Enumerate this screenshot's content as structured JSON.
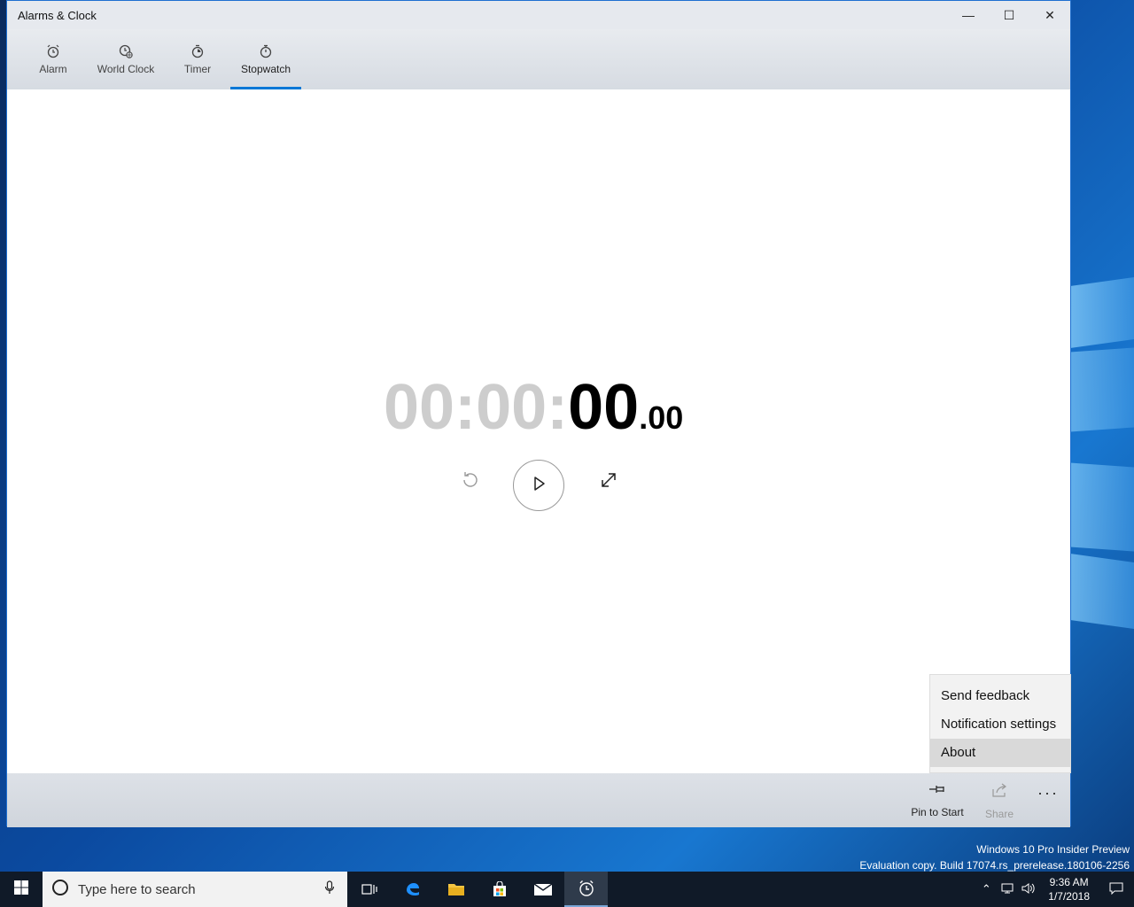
{
  "window": {
    "title": "Alarms & Clock",
    "controls": {
      "minimize": "—",
      "maximize": "☐",
      "close": "✕"
    }
  },
  "tabs": [
    {
      "label": "Alarm",
      "icon": "alarm-clock-icon"
    },
    {
      "label": "World Clock",
      "icon": "world-clock-icon"
    },
    {
      "label": "Timer",
      "icon": "timer-icon"
    },
    {
      "label": "Stopwatch",
      "icon": "stopwatch-icon",
      "active": true
    }
  ],
  "stopwatch": {
    "hours": "00:",
    "minutes": "00:",
    "seconds": "00",
    "fraction": ".00",
    "buttons": {
      "reset": "reset-icon",
      "play": "play-icon",
      "expand": "expand-icon"
    }
  },
  "menu": {
    "items": [
      "Send feedback",
      "Notification settings",
      "About"
    ],
    "highlighted": "About"
  },
  "appbar": {
    "pin_label": "Pin to Start",
    "share_label": "Share",
    "more": "···"
  },
  "watermark": {
    "line1": "Windows 10 Pro Insider Preview",
    "line2": "Evaluation copy. Build 17074.rs_prerelease.180106-2256"
  },
  "taskbar": {
    "search_placeholder": "Type here to search",
    "time": "9:36 AM",
    "date": "1/7/2018",
    "apps": [
      "task-view-icon",
      "edge-icon",
      "file-explorer-icon",
      "store-icon",
      "mail-icon",
      "alarms-clock-icon"
    ]
  },
  "colors": {
    "accent": "#0078d7",
    "dim_digits": "#cdcdcd",
    "taskbar": "#101a28"
  }
}
